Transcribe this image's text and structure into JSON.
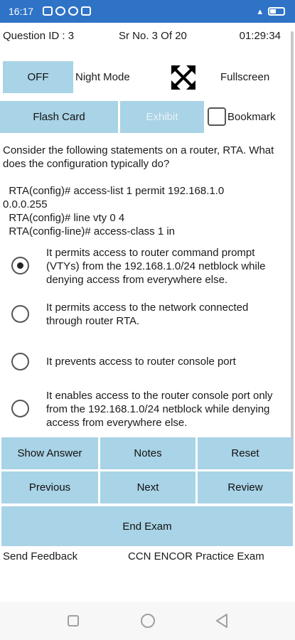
{
  "status_bar": {
    "time": "16:17"
  },
  "header": {
    "question_id": "Question ID : 3",
    "serial": "Sr No. 3 Of 20",
    "timer": "01:29:34"
  },
  "controls": {
    "night_mode_toggle": "OFF",
    "night_mode_label": "Night Mode",
    "fullscreen_label": "Fullscreen",
    "flash_card": "Flash Card",
    "exhibit": "Exhibit",
    "bookmark": "Bookmark"
  },
  "question": {
    "lines": [
      "Consider the following statements on a router, RTA. What",
      "does the configuration typically do?"
    ],
    "config_lines": [
      "  RTA(config)# access-list 1 permit 192.168.1.0",
      "0.0.0.255",
      "  RTA(config)# line vty 0 4",
      "  RTA(config-line)# access-class 1 in"
    ]
  },
  "options": [
    {
      "lines": [
        "It permits access to router command prompt",
        "(VTYs) from the 192.168.1.0/24 netblock while",
        "denying access from everywhere else."
      ],
      "selected": true
    },
    {
      "lines": [
        "It permits access to the network connected",
        "through router RTA."
      ],
      "selected": false
    },
    {
      "lines": [
        "It prevents access to router console port"
      ],
      "selected": false
    },
    {
      "lines": [
        "It enables access to the router console port only",
        "from the 192.168.1.0/24 netblock while denying",
        "access from everywhere else."
      ],
      "selected": false
    }
  ],
  "actions": {
    "show_answer": "Show Answer",
    "notes": "Notes",
    "reset": "Reset",
    "previous": "Previous",
    "next": "Next",
    "review": "Review",
    "end_exam": "End Exam"
  },
  "footer": {
    "send_feedback": "Send Feedback",
    "app_name": "CCN ENCOR Practice Exam"
  },
  "colors": {
    "status_bar": "#2f73c7",
    "button_bg": "#a9d3e6"
  }
}
